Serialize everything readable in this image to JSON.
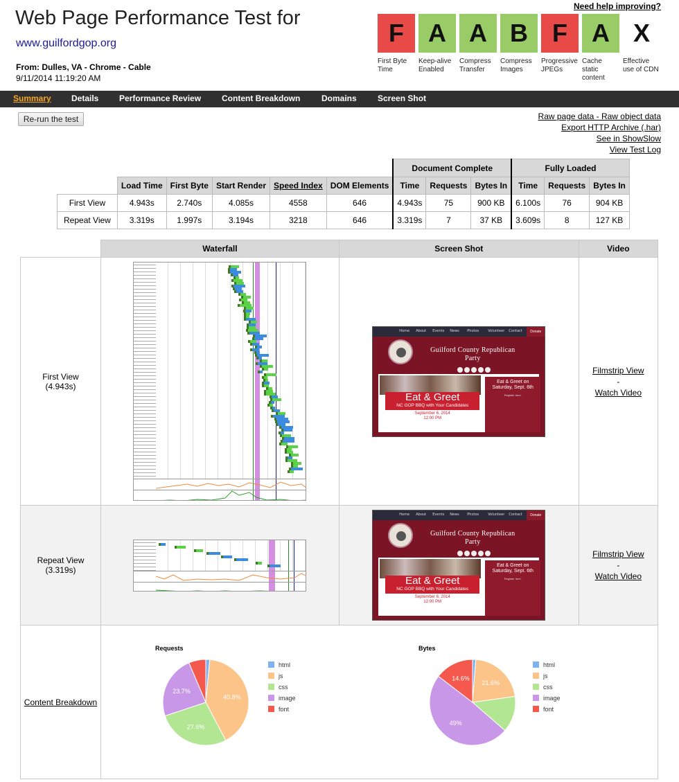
{
  "header": {
    "title": "Web Page Performance Test for",
    "url": "www.guilfordgop.org",
    "from_label": "From:",
    "from_location": "Dulles, VA - ",
    "from_browser": "Chrome - Cable",
    "date": "9/11/2014 11:19:20 AM",
    "help_link": "Need help improving?"
  },
  "grades": [
    {
      "letter": "F",
      "label": "First Byte Time",
      "color": "#e84a48"
    },
    {
      "letter": "A",
      "label": "Keep-alive Enabled",
      "color": "#99cc66"
    },
    {
      "letter": "A",
      "label": "Compress Transfer",
      "color": "#99cc66"
    },
    {
      "letter": "B",
      "label": "Compress Images",
      "color": "#99cc66"
    },
    {
      "letter": "F",
      "label": "Progressive JPEGs",
      "color": "#e84a48"
    },
    {
      "letter": "A",
      "label": "Cache static content",
      "color": "#99cc66"
    },
    {
      "letter": "X",
      "label": "Effective use of CDN",
      "color": "#ffffff"
    }
  ],
  "nav": {
    "items": [
      "Summary",
      "Details",
      "Performance Review",
      "Content Breakdown",
      "Domains",
      "Screen Shot"
    ],
    "active": "Summary"
  },
  "rerun_button": "Re-run the test",
  "right_links": [
    "Raw page data",
    "Raw object data",
    "Export HTTP Archive (.har)",
    "See in ShowSlow",
    "View Test Log"
  ],
  "summary": {
    "group_headers": [
      "Document Complete",
      "Fully Loaded"
    ],
    "columns": [
      "Load Time",
      "First Byte",
      "Start Render",
      "Speed Index",
      "DOM Elements",
      "Time",
      "Requests",
      "Bytes In",
      "Time",
      "Requests",
      "Bytes In"
    ],
    "rows": [
      {
        "label": "First View",
        "values": [
          "4.943s",
          "2.740s",
          "4.085s",
          "4558",
          "646",
          "4.943s",
          "75",
          "900 KB",
          "6.100s",
          "76",
          "904 KB"
        ]
      },
      {
        "label": "Repeat View",
        "values": [
          "3.319s",
          "1.997s",
          "3.194s",
          "3218",
          "646",
          "3.319s",
          "7",
          "37 KB",
          "3.609s",
          "8",
          "127 KB"
        ]
      }
    ]
  },
  "results": {
    "headers": [
      "Waterfall",
      "Screen Shot",
      "Video"
    ],
    "rows": [
      {
        "label": "First View",
        "time": "(4.943s)",
        "filmstrip": "Filmstrip View",
        "dash": "-",
        "watch": "Watch Video"
      },
      {
        "label": "Repeat View",
        "time": "(3.319s)",
        "filmstrip": "Filmstrip View",
        "dash": "-",
        "watch": "Watch Video"
      }
    ],
    "content_breakdown_link": "Content Breakdown"
  },
  "screenshot": {
    "nav_items": [
      "Home",
      "About",
      "Events",
      "News",
      "Photos",
      "Volunteer",
      "Contact"
    ],
    "donate": "Donate",
    "party_title_1": "Guilford County Republican",
    "party_title_2": "Party",
    "banner_big": "Eat & Greet",
    "banner_sub": "NC GOP BBQ with Your Candidates",
    "banner_date": "September 6, 2014",
    "banner_time": "12:00 PM",
    "side_title": "Eat & Greet on Saturday, Sept. 6th",
    "side_sub": "Register here."
  },
  "chart_data": [
    {
      "type": "pie",
      "title": "Requests",
      "categories": [
        "html",
        "js",
        "css",
        "image",
        "font"
      ],
      "colors": [
        "#7fb2f0",
        "#fcc488",
        "#b3e693",
        "#c897e8",
        "#f5584c"
      ],
      "values": [
        1.5,
        40.8,
        27.6,
        23.7,
        6.4
      ],
      "data_labels": [
        "",
        "40.8%",
        "27.6%",
        "23.7%",
        ""
      ]
    },
    {
      "type": "pie",
      "title": "Bytes",
      "categories": [
        "html",
        "js",
        "css",
        "image",
        "font"
      ],
      "colors": [
        "#7fb2f0",
        "#fcc488",
        "#b3e693",
        "#c897e8",
        "#f5584c"
      ],
      "values": [
        1.2,
        21.6,
        13.6,
        49.0,
        14.6
      ],
      "data_labels": [
        "",
        "21.6%",
        "",
        "49%",
        "14.6%"
      ]
    }
  ]
}
